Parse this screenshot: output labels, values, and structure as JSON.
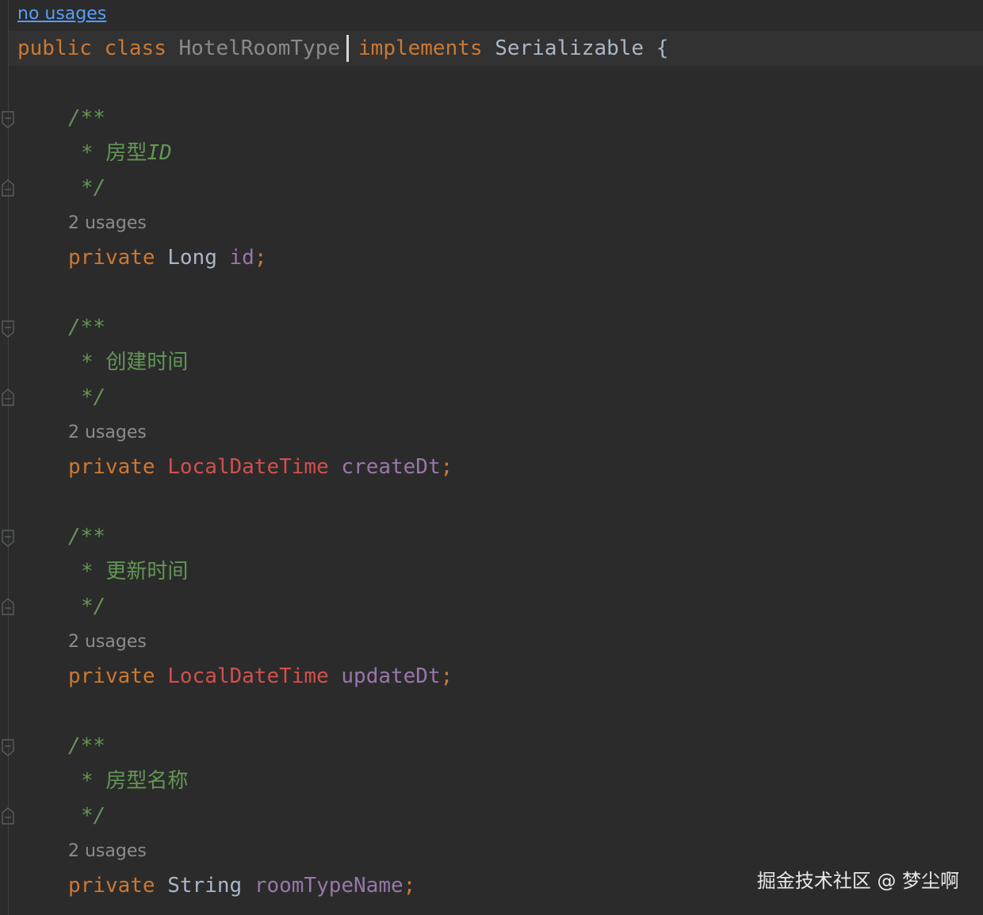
{
  "editor": {
    "class_usages_hint": "no usages",
    "class_decl": {
      "kw_public": "public",
      "kw_class": "class",
      "class_name": "HotelRoomType",
      "kw_implements": "implements",
      "interface_name": "Serializable",
      "brace": "{"
    },
    "fields": [
      {
        "doc_open": "/**",
        "doc_star": "*",
        "doc_text": "房型",
        "doc_text_italic": "ID",
        "doc_close": "*/",
        "usages": "2 usages",
        "modifier": "private",
        "type": "Long",
        "name": "id",
        "semicolon": ";"
      },
      {
        "doc_open": "/**",
        "doc_star": "*",
        "doc_text": "创建时间",
        "doc_text_italic": "",
        "doc_close": "*/",
        "usages": "2 usages",
        "modifier": "private",
        "type": "LocalDateTime",
        "name": "createDt",
        "semicolon": ";"
      },
      {
        "doc_open": "/**",
        "doc_star": "*",
        "doc_text": "更新时间",
        "doc_text_italic": "",
        "doc_close": "*/",
        "usages": "2 usages",
        "modifier": "private",
        "type": "LocalDateTime",
        "name": "updateDt",
        "semicolon": ";"
      },
      {
        "doc_open": "/**",
        "doc_star": "*",
        "doc_text": "房型名称",
        "doc_text_italic": "",
        "doc_close": "*/",
        "usages": "2 usages",
        "modifier": "private",
        "type": "String",
        "name": "roomTypeName",
        "semicolon": ";"
      }
    ]
  },
  "watermark": "掘金技术社区 @ 梦尘啊",
  "colors": {
    "background": "#2b2b2b",
    "keyword": "#cc7832",
    "doc_comment": "#629755",
    "field": "#9876aa",
    "class_red": "#d2504d",
    "link": "#589df6"
  }
}
